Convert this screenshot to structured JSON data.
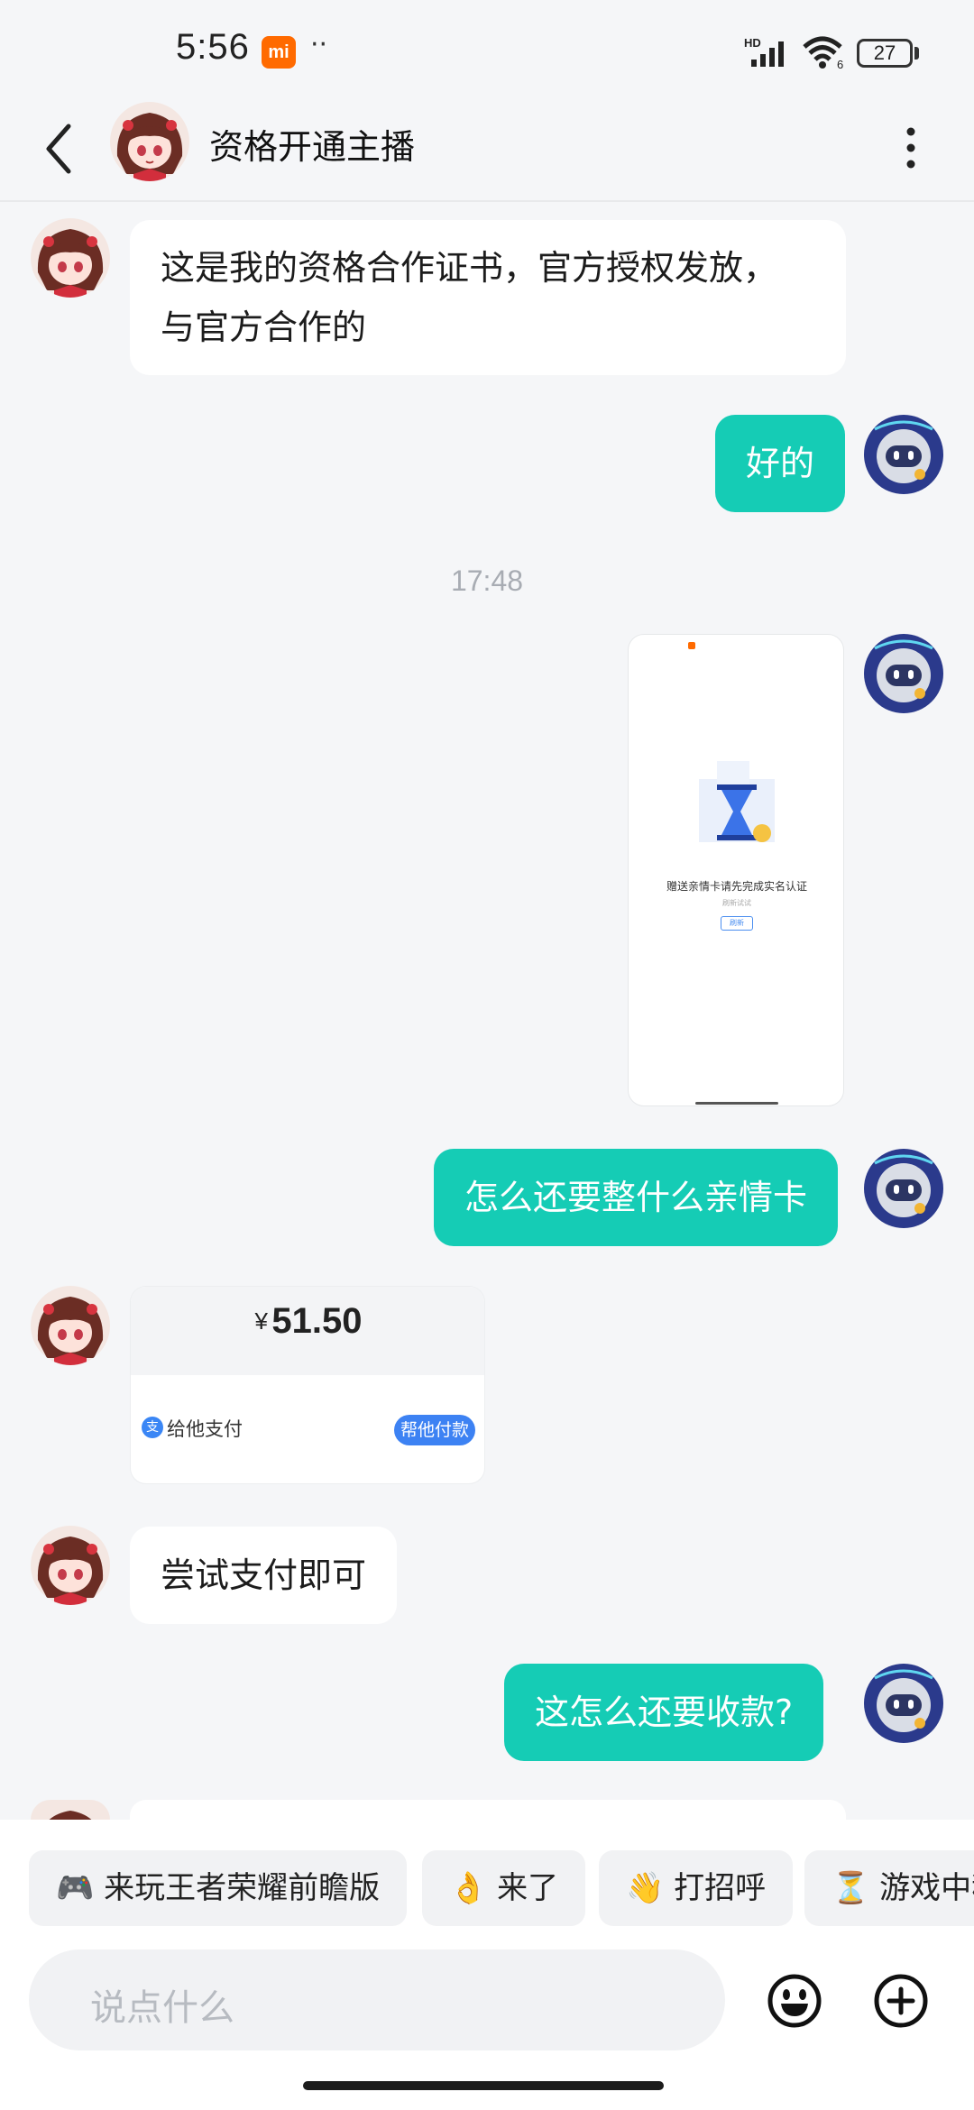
{
  "status_bar": {
    "time": "5:56",
    "mi_badge": "mi",
    "dots": "··",
    "network_label": "HD",
    "wifi_label": "6",
    "battery": "27"
  },
  "header": {
    "title": "资格开通主播"
  },
  "messages": {
    "m1": {
      "line1": "这是我的资格合作证书，官方授权发放，",
      "line2": "与官方合作的"
    },
    "m2": {
      "text": "好的"
    },
    "timestamp": "17:48",
    "image": {
      "caption": "赠送亲情卡请先完成实名认证",
      "sub": "刷新试试",
      "button": "刷新"
    },
    "m4": {
      "text": "怎么还要整什么亲情卡"
    },
    "pay_card": {
      "currency": "¥",
      "amount": "51.50",
      "label": "给他支付",
      "button": "帮他付款"
    },
    "m6": {
      "text": "尝试支付即可"
    },
    "m7": {
      "text": "这怎么还要收款?"
    }
  },
  "quick_replies": [
    {
      "emoji": "🎮",
      "text": "来玩王者荣耀前瞻版"
    },
    {
      "emoji": "👌",
      "text": "来了"
    },
    {
      "emoji": "👋",
      "text": "打招呼"
    },
    {
      "emoji": "⏳",
      "text": "游戏中稍"
    }
  ],
  "input": {
    "placeholder": "说点什么"
  },
  "colors": {
    "outgoing_bubble": "#15ccb5",
    "incoming_bubble": "#ffffff",
    "pay_button": "#3d82f3"
  }
}
